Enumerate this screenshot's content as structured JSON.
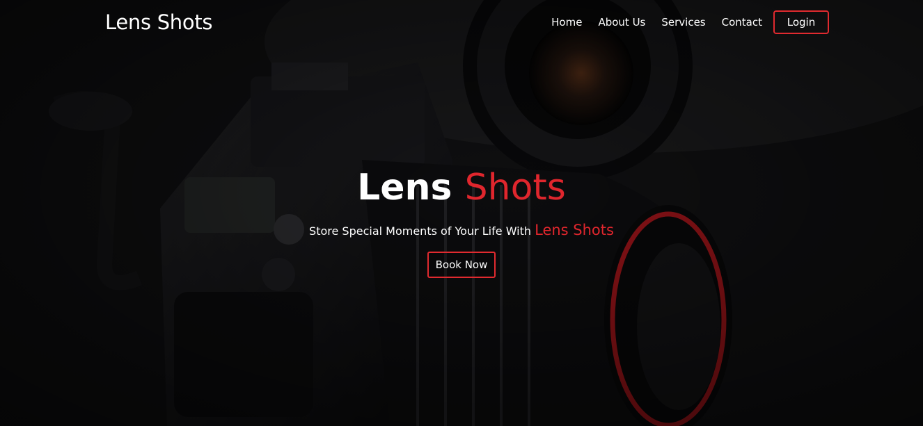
{
  "brand": {
    "name": "Lens Shots"
  },
  "nav": {
    "links": [
      "Home",
      "About Us",
      "Services",
      "Contact"
    ],
    "login_label": "Login"
  },
  "hero": {
    "title_main": "Lens",
    "title_accent": "Shots",
    "subtitle_text": "Store Special Moments of Your Life With",
    "subtitle_accent": "Lens Shots",
    "cta_label": "Book Now",
    "background_image": "camera-photo"
  },
  "colors": {
    "accent": "#e0262d",
    "text": "#ffffff",
    "background": "#0d0d0f"
  }
}
